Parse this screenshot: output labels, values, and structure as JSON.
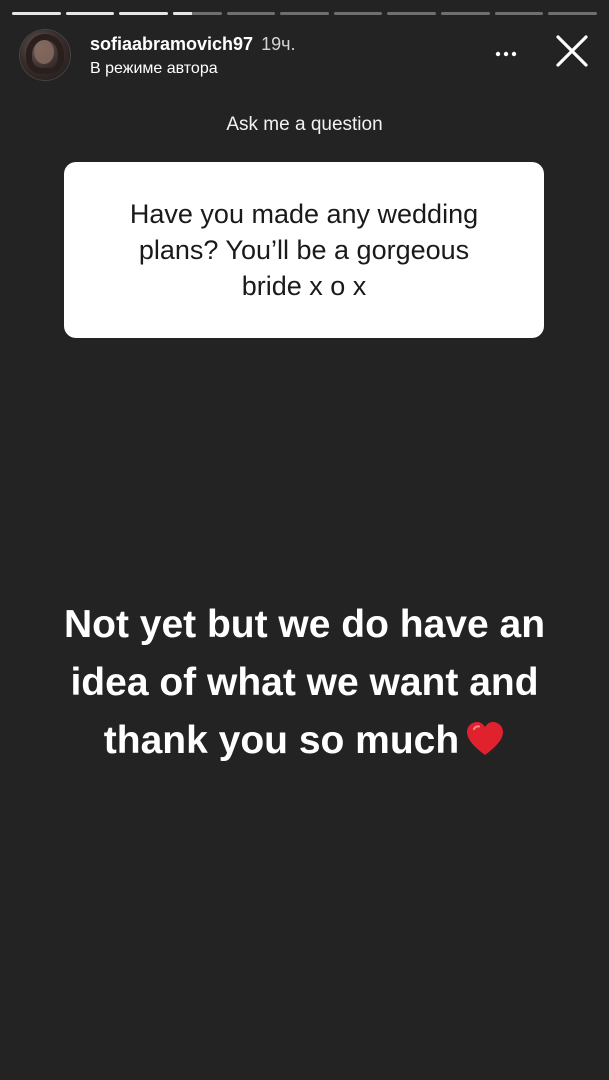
{
  "story": {
    "segments": [
      {
        "progress": 1
      },
      {
        "progress": 1
      },
      {
        "progress": 1
      },
      {
        "progress": 0.4
      },
      {
        "progress": 0
      },
      {
        "progress": 0
      },
      {
        "progress": 0
      },
      {
        "progress": 0
      },
      {
        "progress": 0
      },
      {
        "progress": 0
      },
      {
        "progress": 0
      }
    ]
  },
  "header": {
    "username": "sofiaabramovich97",
    "time": "19ч.",
    "subtitle": "В режиме автора",
    "more_icon": "more-horizontal-icon",
    "close_icon": "close-icon"
  },
  "question_sticker": {
    "title": "Ask me a question",
    "question": "Have you made any wedding plans? You’ll be a gorgeous bride x o x"
  },
  "answer": {
    "text": "Not yet but we do have an idea of what we want and thank you so much",
    "emoji_icon": "red-heart-icon"
  },
  "colors": {
    "background": "#232323",
    "card": "#ffffff",
    "heart": "#e0212e"
  }
}
